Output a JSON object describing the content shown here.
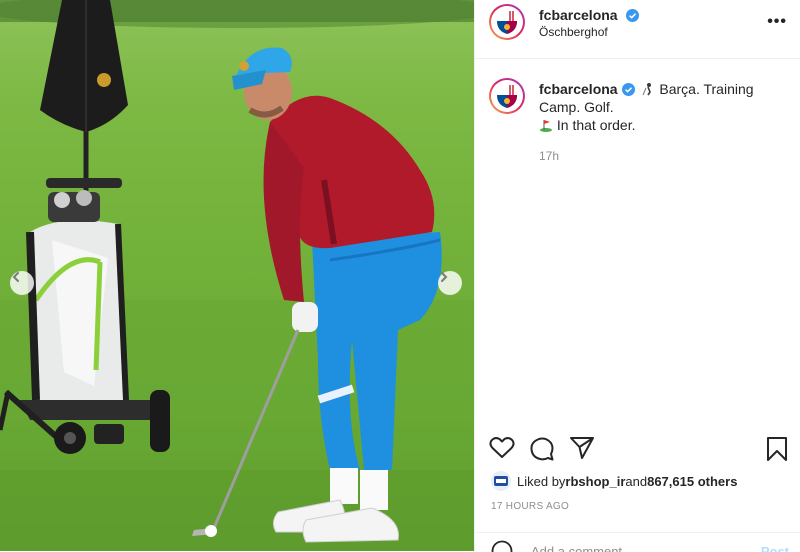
{
  "post": {
    "username": "fcbarcelona",
    "location": "Öschberghof",
    "caption_user": "fcbarcelona",
    "caption_line1": " Barça. Training Camp. Golf.",
    "caption_line2": " In that order.",
    "posted_ago": "17h",
    "liked_prefix": "Liked by ",
    "liked_user": "rbshop_ir",
    "liked_middle": " and ",
    "liked_count": "867,615 others",
    "timestamp": "17 HOURS AGO"
  },
  "comment": {
    "placeholder": "Add a comment...",
    "post_label": "Post"
  },
  "icons": {
    "heart": "heart-icon",
    "comment": "comment-icon",
    "share": "share-icon",
    "save": "bookmark-icon",
    "more": "more-icon",
    "verified": "verified-icon",
    "prev": "chevron-left-icon",
    "next": "chevron-right-icon"
  },
  "colors": {
    "verified_blue": "#3897f0",
    "text": "#262626",
    "muted": "#8e8e8e",
    "border": "#efefef",
    "club_red": "#a50044",
    "club_blue": "#004d98"
  }
}
